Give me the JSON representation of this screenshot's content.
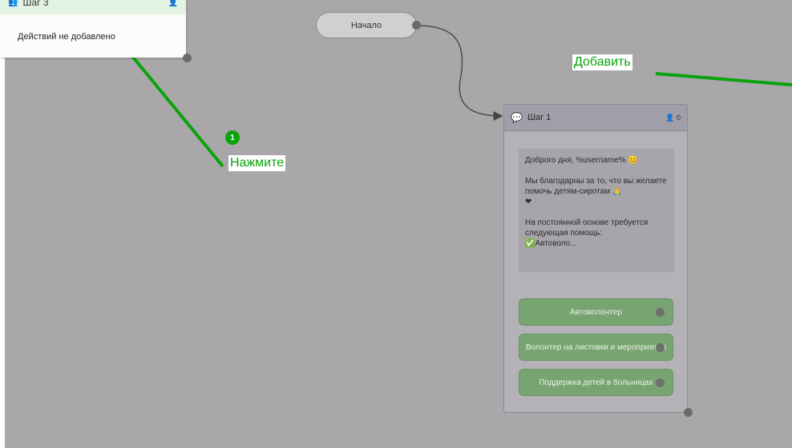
{
  "card3": {
    "title": "Шаг 3",
    "empty_text": "Действий не добавлено"
  },
  "start_node": {
    "label": "Начало"
  },
  "step1": {
    "title": "Шаг 1",
    "subscribers": "0",
    "message": "Доброго дня, %username% 😊\n\nМы благодарны за то, что вы желаете помочь детям-сиротам 🙏\n❤\n\nНа постоянной основе требуется следующая помощь:\n✅Автоволо...",
    "buttons": [
      {
        "label": "Автоволонтер"
      },
      {
        "label": "Волонтер на листовки и мероприятия"
      },
      {
        "label": "Поддержка детей в больницах"
      }
    ]
  },
  "annotations": {
    "press_label": "Нажмите",
    "press_badge": "1",
    "add_label": "Добавить"
  },
  "colors": {
    "canvas": "#aaa7ab",
    "annotation": "#0aa30c",
    "button": "#78a471"
  }
}
